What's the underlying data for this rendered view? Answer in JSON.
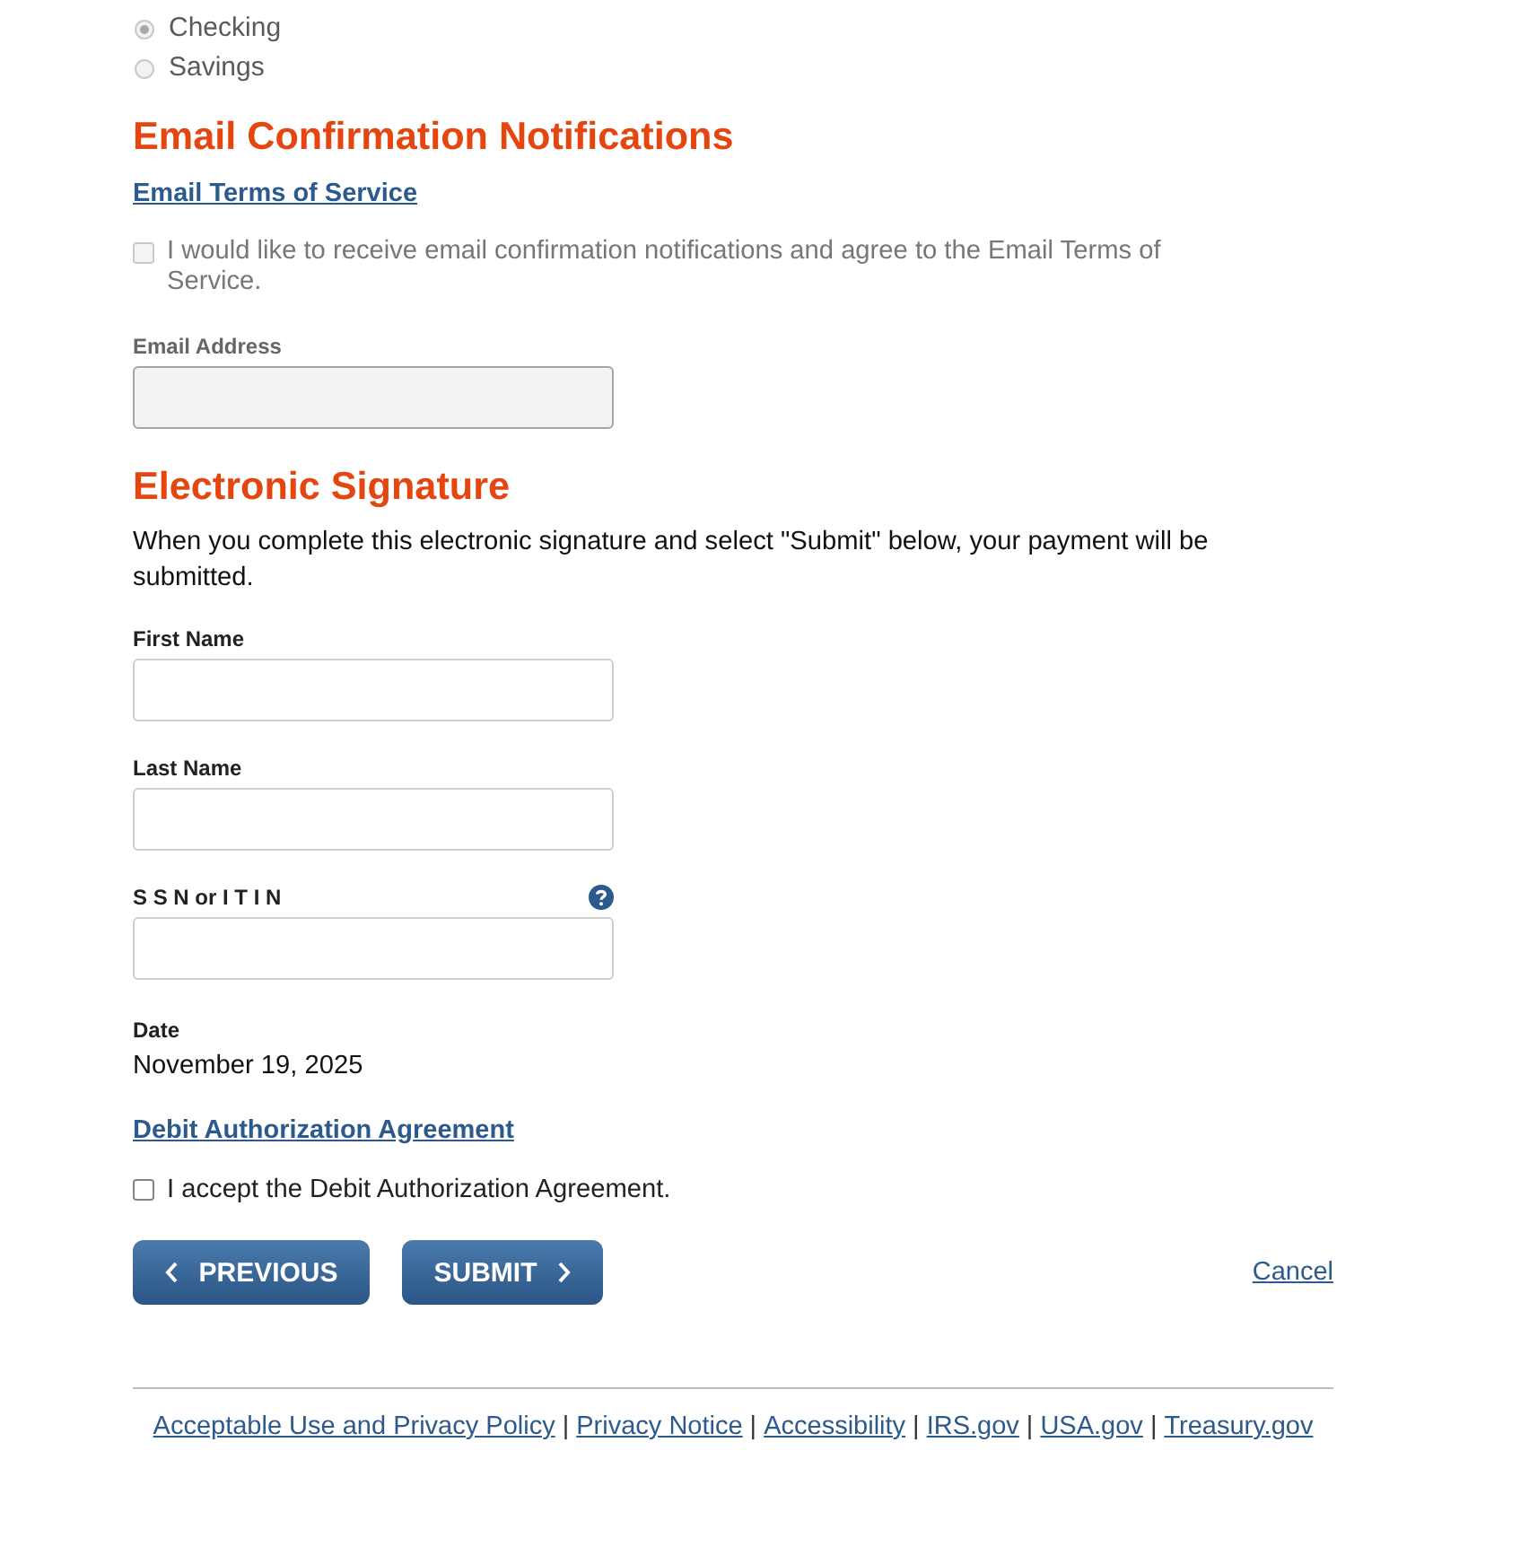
{
  "account_type": {
    "disabled": true,
    "options": [
      {
        "label": "Checking",
        "selected": true
      },
      {
        "label": "Savings",
        "selected": false
      }
    ]
  },
  "email_section": {
    "heading": "Email Confirmation Notifications",
    "terms_link": "Email Terms of Service",
    "consent": {
      "label": "I would like to receive email confirmation notifications and agree to the Email Terms of Service.",
      "checked": false,
      "disabled": true
    },
    "email_field": {
      "label": "Email Address",
      "disabled": true
    }
  },
  "signature_section": {
    "heading": "Electronic Signature",
    "intro": "When you complete this electronic signature and select \"Submit\" below, your payment will be submitted.",
    "fields": [
      {
        "label": "First Name",
        "help": false
      },
      {
        "label": "Last Name",
        "help": false
      },
      {
        "label": "S S N or I T I N",
        "help": true
      }
    ],
    "date": {
      "label": "Date",
      "value": "November 19, 2025"
    },
    "agreement_link": "Debit Authorization Agreement",
    "accept": {
      "label": "I accept the Debit Authorization Agreement.",
      "checked": false,
      "disabled": false
    }
  },
  "actions": [
    {
      "label": "PREVIOUS",
      "kind": "back"
    },
    {
      "label": "SUBMIT",
      "kind": "next"
    }
  ],
  "cancel": "Cancel",
  "footer": {
    "separator": "|",
    "links": [
      "Acceptable Use and Privacy Policy",
      "Privacy Notice",
      "Accessibility",
      "IRS.gov",
      "USA.gov",
      "Treasury.gov"
    ]
  }
}
